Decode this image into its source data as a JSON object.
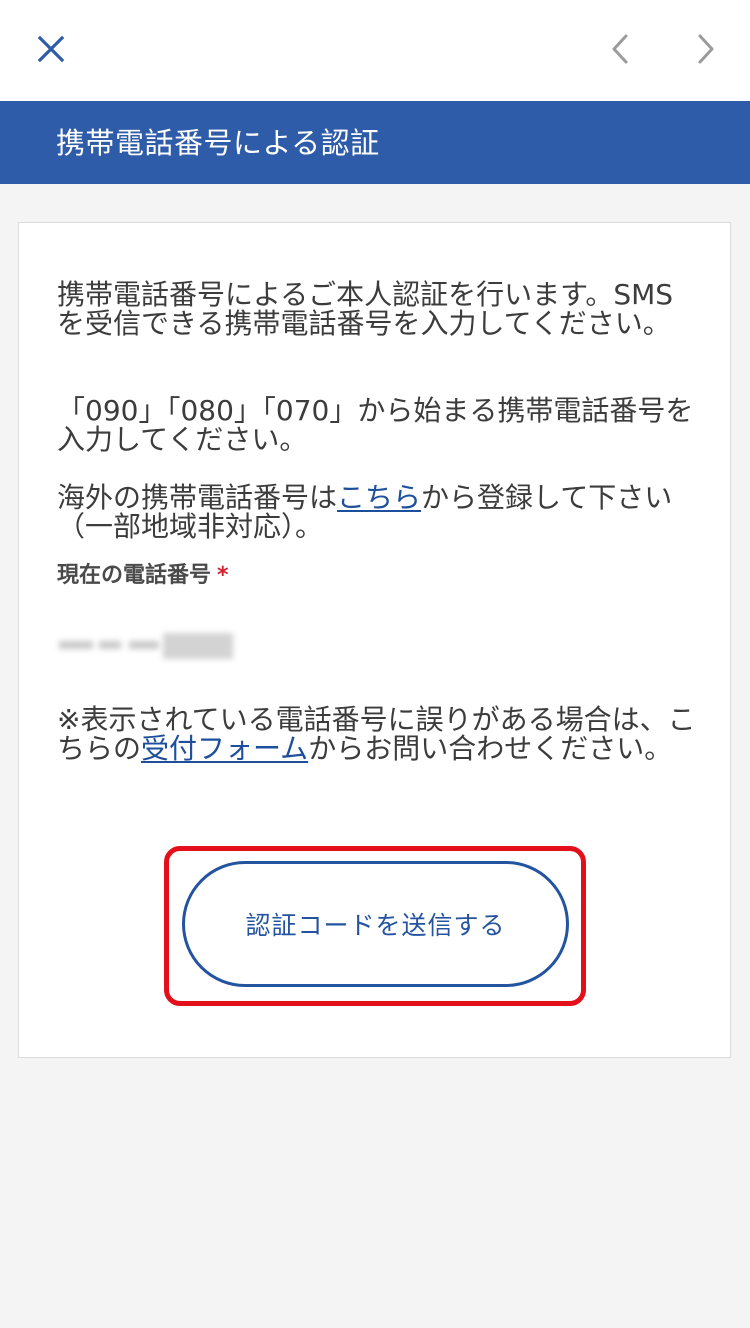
{
  "header": {
    "close_icon": "close-icon",
    "prev_icon": "chevron-left-icon",
    "next_icon": "chevron-right-icon"
  },
  "titlebar": {
    "title": "携帯電話番号による認証"
  },
  "card": {
    "intro_line": "携帯電話番号によるご本人認証を行います。SMSを受信できる携帯電話番号を入力してください。",
    "format_note": "「090」「080」「070」から始まる携帯電話番号を入力してください。",
    "overseas_before": "海外の携帯電話番号は",
    "overseas_link": "こちら",
    "overseas_after": "から登録して下さい（一部地域非対応）。",
    "current_phone_label": "現在の電話番号",
    "required_mark": "*",
    "error_note_before": "※表示されている電話番号に誤りがある場合は、こちらの",
    "error_note_link": "受付フォーム",
    "error_note_after": "からお問い合わせください。",
    "send_button": "認証コードを送信する"
  },
  "colors": {
    "brand_blue": "#2f5ca8",
    "link_blue": "#1e4f9c",
    "highlight_red": "#e3101c",
    "required_red": "#d21f2b"
  }
}
